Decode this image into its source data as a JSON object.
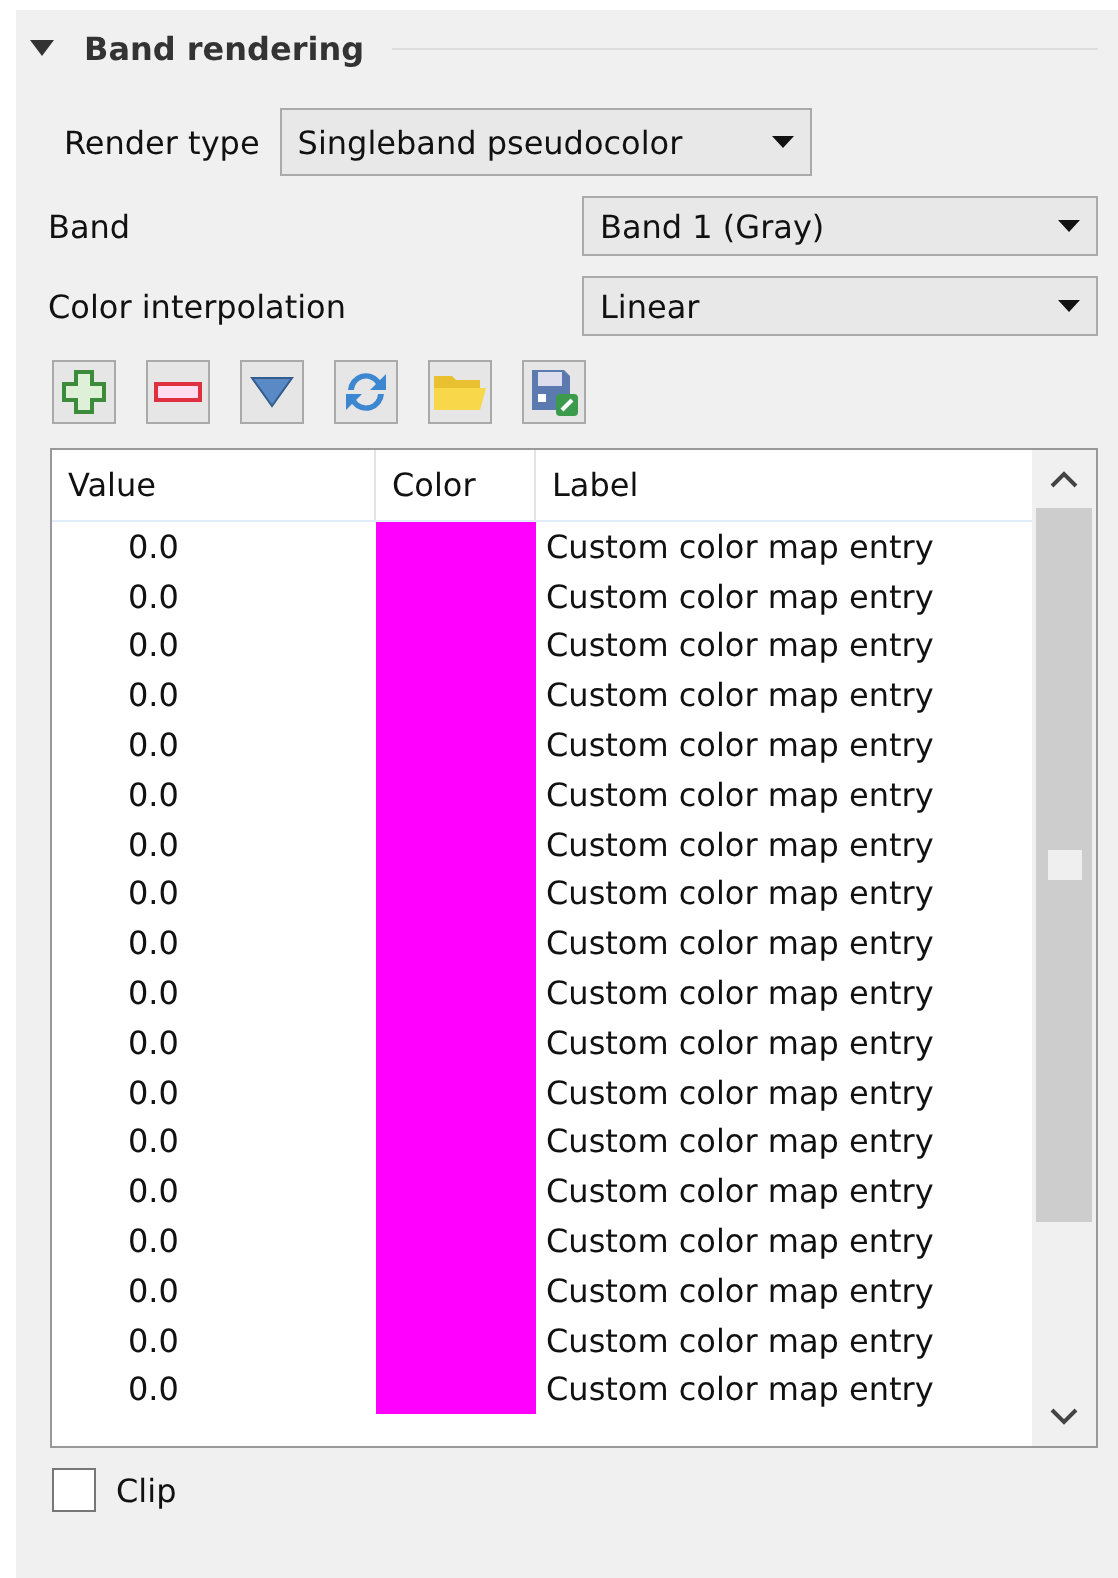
{
  "section": {
    "title": "Band rendering",
    "expanded": true
  },
  "render_type": {
    "label": "Render type",
    "value": "Singleband pseudocolor"
  },
  "band": {
    "label": "Band",
    "value": "Band 1 (Gray)"
  },
  "color_interpolation": {
    "label": "Color interpolation",
    "value": "Linear"
  },
  "toolbar": [
    {
      "kind": "add"
    },
    {
      "kind": "remove"
    },
    {
      "kind": "down"
    },
    {
      "kind": "refresh"
    },
    {
      "kind": "open"
    },
    {
      "kind": "save"
    }
  ],
  "table": {
    "columns": [
      "Value",
      "Color",
      "Label"
    ],
    "rows": [
      {
        "value": "0.0",
        "color": "#ff00ff",
        "label": "Custom color map entry"
      },
      {
        "value": "0.0",
        "color": "#ff00ff",
        "label": "Custom color map entry"
      },
      {
        "value": "0.0",
        "color": "#ff00ff",
        "label": "Custom color map entry"
      },
      {
        "value": "0.0",
        "color": "#ff00ff",
        "label": "Custom color map entry"
      },
      {
        "value": "0.0",
        "color": "#ff00ff",
        "label": "Custom color map entry"
      },
      {
        "value": "0.0",
        "color": "#ff00ff",
        "label": "Custom color map entry"
      },
      {
        "value": "0.0",
        "color": "#ff00ff",
        "label": "Custom color map entry"
      },
      {
        "value": "0.0",
        "color": "#ff00ff",
        "label": "Custom color map entry"
      },
      {
        "value": "0.0",
        "color": "#ff00ff",
        "label": "Custom color map entry"
      },
      {
        "value": "0.0",
        "color": "#ff00ff",
        "label": "Custom color map entry"
      },
      {
        "value": "0.0",
        "color": "#ff00ff",
        "label": "Custom color map entry"
      },
      {
        "value": "0.0",
        "color": "#ff00ff",
        "label": "Custom color map entry"
      },
      {
        "value": "0.0",
        "color": "#ff00ff",
        "label": "Custom color map entry"
      },
      {
        "value": "0.0",
        "color": "#ff00ff",
        "label": "Custom color map entry"
      },
      {
        "value": "0.0",
        "color": "#ff00ff",
        "label": "Custom color map entry"
      },
      {
        "value": "0.0",
        "color": "#ff00ff",
        "label": "Custom color map entry"
      },
      {
        "value": "0.0",
        "color": "#ff00ff",
        "label": "Custom color map entry"
      },
      {
        "value": "0.0",
        "color": "#ff00ff",
        "label": "Custom color map entry"
      }
    ]
  },
  "clip": {
    "label": "Clip",
    "checked": false
  }
}
